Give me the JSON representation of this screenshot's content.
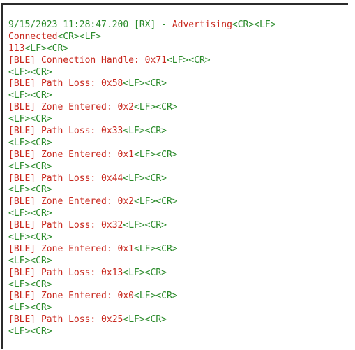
{
  "colors": {
    "message": "#c8281e",
    "control": "#2a8a2a",
    "border": "#2b2b2b"
  },
  "log": {
    "lines": [
      [
        {
          "text": "9/15/2023 11:28:47.200 [RX] - ",
          "color": "control"
        },
        {
          "text": "Advertising",
          "color": "message"
        },
        {
          "text": "<CR><LF>",
          "color": "control"
        }
      ],
      [
        {
          "text": "Connected",
          "color": "message"
        },
        {
          "text": "<CR><LF>",
          "color": "control"
        }
      ],
      [
        {
          "text": "113",
          "color": "message"
        },
        {
          "text": "<LF><CR>",
          "color": "control"
        }
      ],
      [
        {
          "text": "[BLE] Connection Handle: 0x71",
          "color": "message"
        },
        {
          "text": "<LF><CR>",
          "color": "control"
        }
      ],
      [
        {
          "text": "<LF><CR>",
          "color": "control"
        }
      ],
      [
        {
          "text": "[BLE] Path Loss: 0x58",
          "color": "message"
        },
        {
          "text": "<LF><CR>",
          "color": "control"
        }
      ],
      [
        {
          "text": "<LF><CR>",
          "color": "control"
        }
      ],
      [
        {
          "text": "[BLE] Zone Entered: 0x2",
          "color": "message"
        },
        {
          "text": "<LF><CR>",
          "color": "control"
        }
      ],
      [
        {
          "text": "<LF><CR>",
          "color": "control"
        }
      ],
      [
        {
          "text": "[BLE] Path Loss: 0x33",
          "color": "message"
        },
        {
          "text": "<LF><CR>",
          "color": "control"
        }
      ],
      [
        {
          "text": "<LF><CR>",
          "color": "control"
        }
      ],
      [
        {
          "text": "[BLE] Zone Entered: 0x1",
          "color": "message"
        },
        {
          "text": "<LF><CR>",
          "color": "control"
        }
      ],
      [
        {
          "text": "<LF><CR>",
          "color": "control"
        }
      ],
      [
        {
          "text": "[BLE] Path Loss: 0x44",
          "color": "message"
        },
        {
          "text": "<LF><CR>",
          "color": "control"
        }
      ],
      [
        {
          "text": "<LF><CR>",
          "color": "control"
        }
      ],
      [
        {
          "text": "[BLE] Zone Entered: 0x2",
          "color": "message"
        },
        {
          "text": "<LF><CR>",
          "color": "control"
        }
      ],
      [
        {
          "text": "<LF><CR>",
          "color": "control"
        }
      ],
      [
        {
          "text": "[BLE] Path Loss: 0x32",
          "color": "message"
        },
        {
          "text": "<LF><CR>",
          "color": "control"
        }
      ],
      [
        {
          "text": "<LF><CR>",
          "color": "control"
        }
      ],
      [
        {
          "text": "[BLE] Zone Entered: 0x1",
          "color": "message"
        },
        {
          "text": "<LF><CR>",
          "color": "control"
        }
      ],
      [
        {
          "text": "<LF><CR>",
          "color": "control"
        }
      ],
      [
        {
          "text": "[BLE] Path Loss: 0x13",
          "color": "message"
        },
        {
          "text": "<LF><CR>",
          "color": "control"
        }
      ],
      [
        {
          "text": "<LF><CR>",
          "color": "control"
        }
      ],
      [
        {
          "text": "[BLE] Zone Entered: 0x0",
          "color": "message"
        },
        {
          "text": "<LF><CR>",
          "color": "control"
        }
      ],
      [
        {
          "text": "<LF><CR>",
          "color": "control"
        }
      ],
      [
        {
          "text": "[BLE] Path Loss: 0x25",
          "color": "message"
        },
        {
          "text": "<LF><CR>",
          "color": "control"
        }
      ],
      [
        {
          "text": "<LF><CR>",
          "color": "control"
        }
      ]
    ]
  }
}
